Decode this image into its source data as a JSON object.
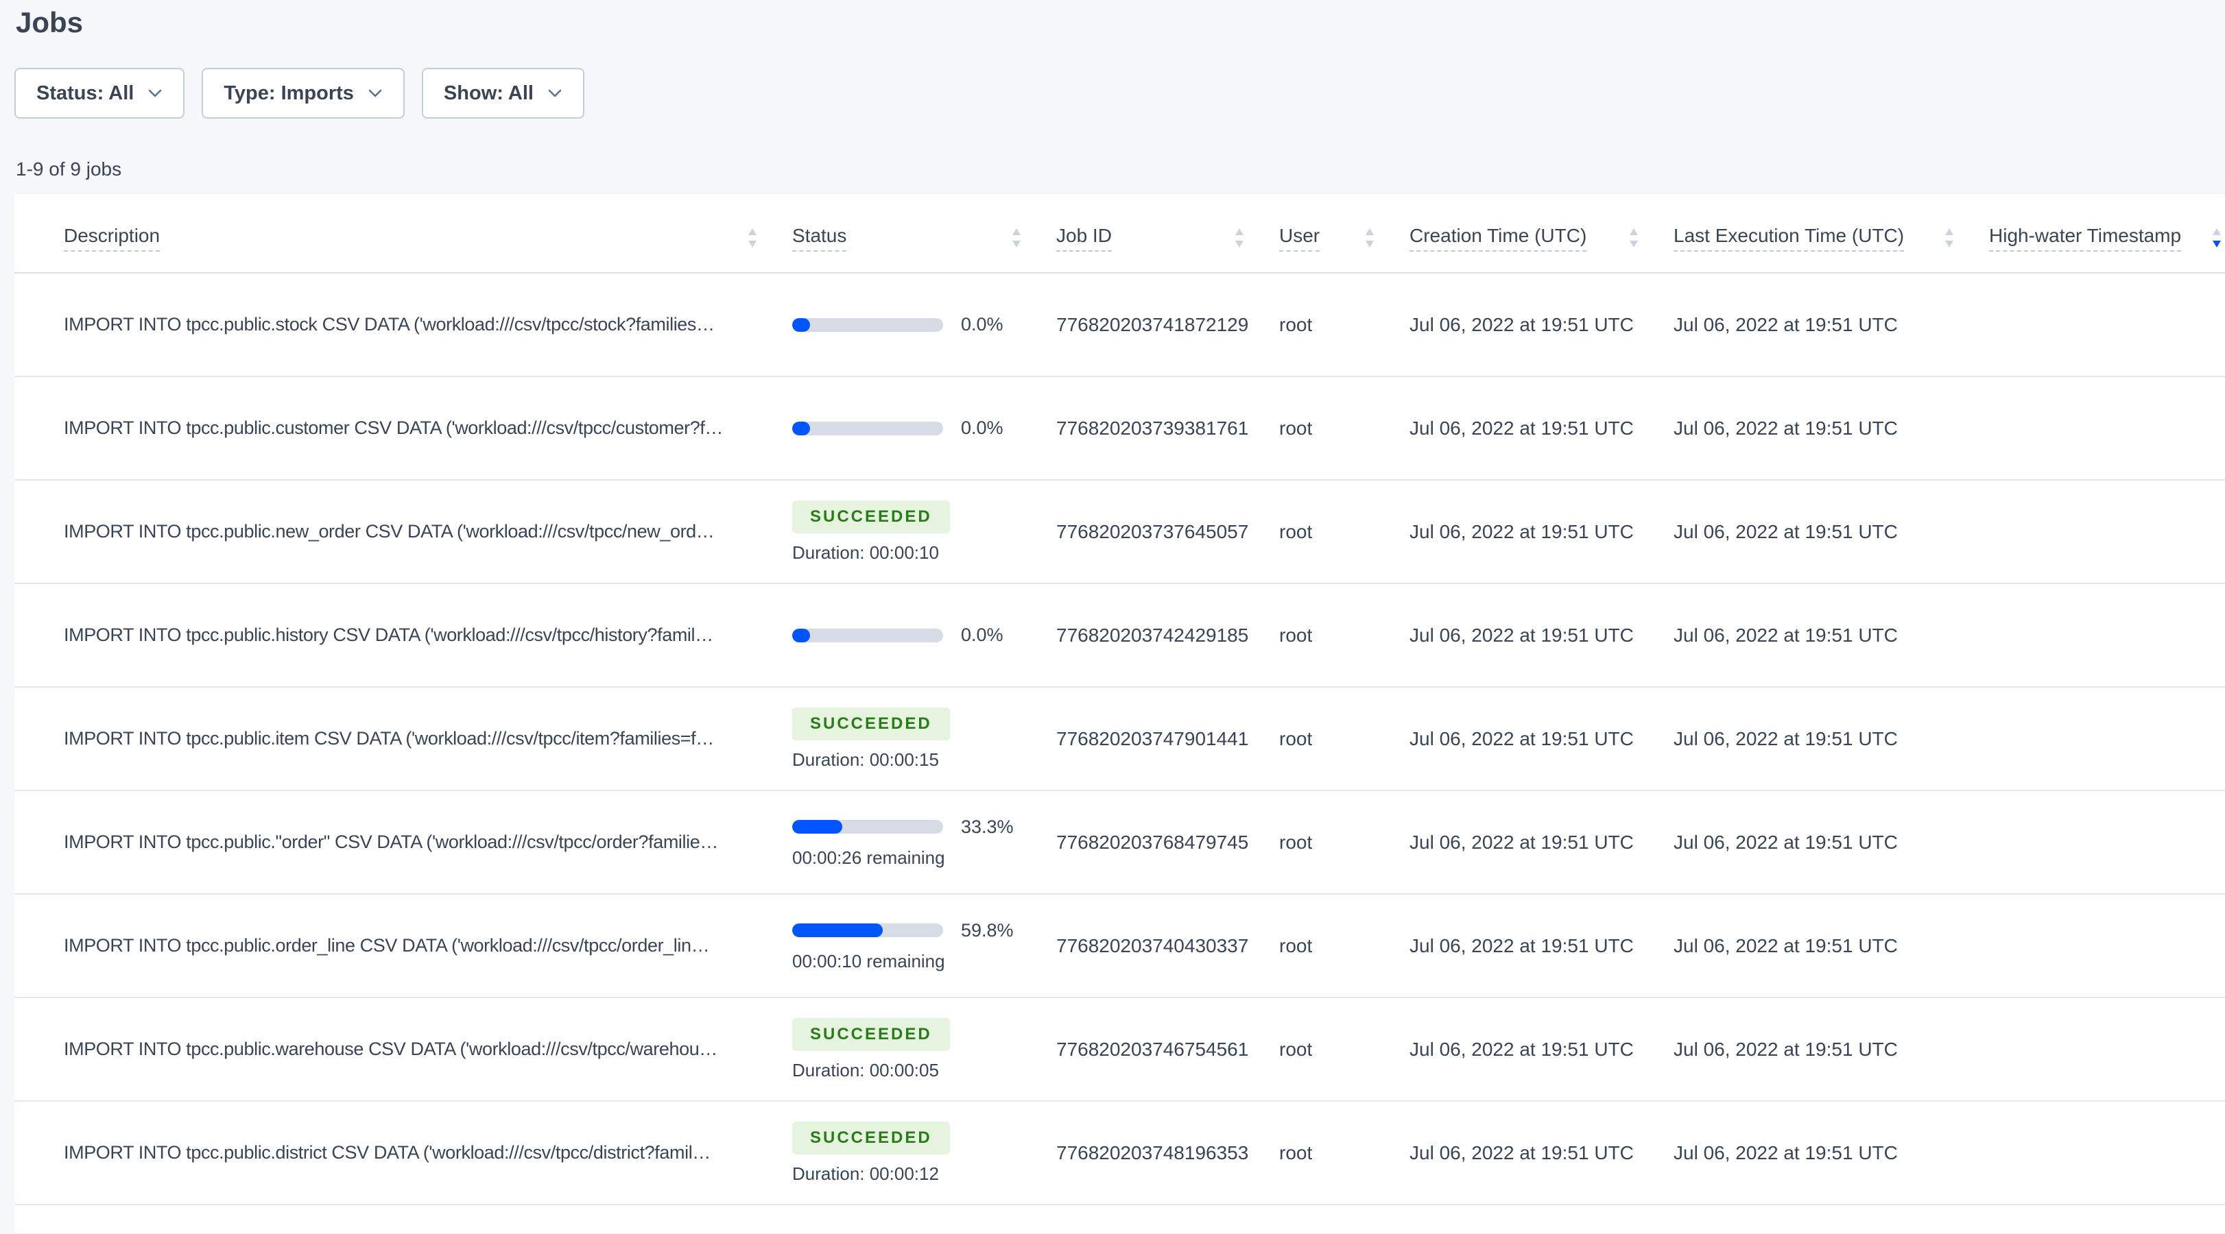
{
  "page": {
    "title": "Jobs"
  },
  "filters": {
    "status_label": "Status: All",
    "type_label": "Type: Imports",
    "show_label": "Show: All"
  },
  "summary": "1-9 of 9 jobs",
  "colors": {
    "accent_blue": "#0055ff",
    "success_green": "#287d19",
    "success_bg": "#e5f3df",
    "sort_arrow_gray": "#ccd3de",
    "progress_track": "#d6dbe5",
    "page_bg": "#f5f7fa"
  },
  "table": {
    "columns": [
      {
        "key": "description",
        "label": "Description",
        "sort": "none"
      },
      {
        "key": "status",
        "label": "Status",
        "sort": "none"
      },
      {
        "key": "job-id",
        "label": "Job ID",
        "sort": "none"
      },
      {
        "key": "user",
        "label": "User",
        "sort": "none"
      },
      {
        "key": "creation-time",
        "label": "Creation Time (UTC)",
        "sort": "none"
      },
      {
        "key": "last-execution-time",
        "label": "Last Execution Time (UTC)",
        "sort": "none"
      },
      {
        "key": "high-water-timestamp",
        "label": "High-water Timestamp",
        "sort": "desc"
      }
    ],
    "rows": [
      {
        "description": "IMPORT INTO tpcc.public.stock CSV DATA ('workload:///csv/tpcc/stock?families…",
        "status": {
          "type": "progress",
          "percent_label": "0.0%",
          "percent_value": 0.0,
          "remaining": ""
        },
        "job_id": "776820203741872129",
        "user": "root",
        "creation_time": "Jul 06, 2022 at 19:51 UTC",
        "last_execution_time": "Jul 06, 2022 at 19:51 UTC",
        "high_water_timestamp": ""
      },
      {
        "description": "IMPORT INTO tpcc.public.customer CSV DATA ('workload:///csv/tpcc/customer?f…",
        "status": {
          "type": "progress",
          "percent_label": "0.0%",
          "percent_value": 0.0,
          "remaining": ""
        },
        "job_id": "776820203739381761",
        "user": "root",
        "creation_time": "Jul 06, 2022 at 19:51 UTC",
        "last_execution_time": "Jul 06, 2022 at 19:51 UTC",
        "high_water_timestamp": ""
      },
      {
        "description": "IMPORT INTO tpcc.public.new_order CSV DATA ('workload:///csv/tpcc/new_ord…",
        "status": {
          "type": "succeeded",
          "badge_label": "SUCCEEDED",
          "duration": "Duration: 00:00:10"
        },
        "job_id": "776820203737645057",
        "user": "root",
        "creation_time": "Jul 06, 2022 at 19:51 UTC",
        "last_execution_time": "Jul 06, 2022 at 19:51 UTC",
        "high_water_timestamp": ""
      },
      {
        "description": "IMPORT INTO tpcc.public.history CSV DATA ('workload:///csv/tpcc/history?famil…",
        "status": {
          "type": "progress",
          "percent_label": "0.0%",
          "percent_value": 0.0,
          "remaining": ""
        },
        "job_id": "776820203742429185",
        "user": "root",
        "creation_time": "Jul 06, 2022 at 19:51 UTC",
        "last_execution_time": "Jul 06, 2022 at 19:51 UTC",
        "high_water_timestamp": ""
      },
      {
        "description": "IMPORT INTO tpcc.public.item CSV DATA ('workload:///csv/tpcc/item?families=f…",
        "status": {
          "type": "succeeded",
          "badge_label": "SUCCEEDED",
          "duration": "Duration: 00:00:15"
        },
        "job_id": "776820203747901441",
        "user": "root",
        "creation_time": "Jul 06, 2022 at 19:51 UTC",
        "last_execution_time": "Jul 06, 2022 at 19:51 UTC",
        "high_water_timestamp": ""
      },
      {
        "description": "IMPORT INTO tpcc.public.\"order\" CSV DATA ('workload:///csv/tpcc/order?familie…",
        "status": {
          "type": "progress",
          "percent_label": "33.3%",
          "percent_value": 33.3,
          "remaining": "00:00:26 remaining"
        },
        "job_id": "776820203768479745",
        "user": "root",
        "creation_time": "Jul 06, 2022 at 19:51 UTC",
        "last_execution_time": "Jul 06, 2022 at 19:51 UTC",
        "high_water_timestamp": ""
      },
      {
        "description": "IMPORT INTO tpcc.public.order_line CSV DATA ('workload:///csv/tpcc/order_lin…",
        "status": {
          "type": "progress",
          "percent_label": "59.8%",
          "percent_value": 59.8,
          "remaining": "00:00:10 remaining"
        },
        "job_id": "776820203740430337",
        "user": "root",
        "creation_time": "Jul 06, 2022 at 19:51 UTC",
        "last_execution_time": "Jul 06, 2022 at 19:51 UTC",
        "high_water_timestamp": ""
      },
      {
        "description": "IMPORT INTO tpcc.public.warehouse CSV DATA ('workload:///csv/tpcc/warehou…",
        "status": {
          "type": "succeeded",
          "badge_label": "SUCCEEDED",
          "duration": "Duration: 00:00:05"
        },
        "job_id": "776820203746754561",
        "user": "root",
        "creation_time": "Jul 06, 2022 at 19:51 UTC",
        "last_execution_time": "Jul 06, 2022 at 19:51 UTC",
        "high_water_timestamp": ""
      },
      {
        "description": "IMPORT INTO tpcc.public.district CSV DATA ('workload:///csv/tpcc/district?famil…",
        "status": {
          "type": "succeeded",
          "badge_label": "SUCCEEDED",
          "duration": "Duration: 00:00:12"
        },
        "job_id": "776820203748196353",
        "user": "root",
        "creation_time": "Jul 06, 2022 at 19:51 UTC",
        "last_execution_time": "Jul 06, 2022 at 19:51 UTC",
        "high_water_timestamp": ""
      }
    ]
  }
}
